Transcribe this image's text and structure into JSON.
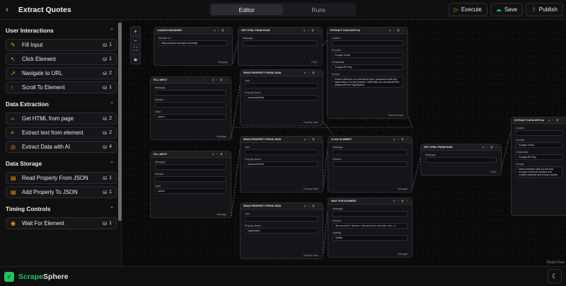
{
  "header": {
    "back_icon": "chevron-left-icon",
    "title": "Extract Quotes",
    "tabs": [
      "Editor",
      "Runs"
    ],
    "execute_label": "Execute",
    "save_label": "Save",
    "publish_label": "Publish"
  },
  "sidebar": {
    "sections": [
      {
        "title": "User Interactions",
        "items": [
          {
            "label": "Fill Input",
            "count": "1",
            "icon": "input-icon"
          },
          {
            "label": "Click Element",
            "count": "1",
            "icon": "cursor-click-icon"
          },
          {
            "label": "Navigate to URL",
            "count": "2",
            "icon": "link-icon"
          },
          {
            "label": "Scroll To Element",
            "count": "1",
            "icon": "arrow-up-icon"
          }
        ]
      },
      {
        "title": "Data Extraction",
        "items": [
          {
            "label": "Get HTML from page",
            "count": "2",
            "icon": "code-icon"
          },
          {
            "label": "Extract text from element",
            "count": "2",
            "icon": "text-icon"
          },
          {
            "label": "Extract Data with AI",
            "count": "4",
            "icon": "brain-icon"
          }
        ]
      },
      {
        "title": "Data Storage",
        "items": [
          {
            "label": "Read Property From JSON",
            "count": "1",
            "icon": "file-json-icon"
          },
          {
            "label": "Add Property To JSON",
            "count": "1",
            "icon": "file-plus-icon"
          }
        ]
      },
      {
        "title": "Timing Controls",
        "items": [
          {
            "label": "Wait For Element",
            "count": "1",
            "icon": "eye-icon"
          }
        ]
      }
    ]
  },
  "footer": {
    "brand_a": "Scrape",
    "brand_b": "Sphere",
    "attribution": "React Flow"
  },
  "nodes": [
    {
      "title": "LAUNCH BROWSER",
      "fields": [
        {
          "label": "Website Url",
          "value": "https://quotes.toscrape.com/login"
        }
      ],
      "out": "Webpage"
    },
    {
      "title": "GET HTML FROM PAGE",
      "fields": [
        {
          "label": "Webpage",
          "value": ""
        }
      ],
      "out": "HTML"
    },
    {
      "title": "EXTRACT DATA WITH AI",
      "fields": [
        {
          "label": "Content",
          "value": ""
        },
        {
          "label": "Provider",
          "value": "Google GenAI"
        },
        {
          "label": "Credentials",
          "value": "Google API Key"
        },
        {
          "label": "Prompt",
          "value": "Extract selectors for username input, password input and login button in a json format. Label them as usernameField, passwordField, loginButton"
        }
      ],
      "out": "Extracted Data"
    },
    {
      "title": "FILL INPUT",
      "fields": [
        {
          "label": "Webpage",
          "value": ""
        },
        {
          "label": "Selector",
          "value": ""
        },
        {
          "label": "Value",
          "value": "admin"
        }
      ],
      "out": "Webpage"
    },
    {
      "title": "READ PROPERTY FROM JSON",
      "fields": [
        {
          "label": "Json",
          "value": ""
        },
        {
          "label": "Property Name",
          "value": "usernameField"
        }
      ],
      "out": "Property Value"
    },
    {
      "title": "READ PROPERTY FROM JSON",
      "fields": [
        {
          "label": "Json",
          "value": ""
        },
        {
          "label": "Property Name",
          "value": "passwordField"
        }
      ],
      "out": "Property Value"
    },
    {
      "title": "CLICK ELEMENT",
      "fields": [
        {
          "label": "Webpage",
          "value": ""
        },
        {
          "label": "Selector",
          "value": ""
        }
      ],
      "out": "Webpage"
    },
    {
      "title": "GET HTML FROM PAGE",
      "fields": [
        {
          "label": "Webpage",
          "value": ""
        }
      ],
      "out": "HTML"
    },
    {
      "title": "EXTRACT DATA WITH AI",
      "fields": [
        {
          "label": "Content",
          "value": ""
        },
        {
          "label": "Provider",
          "value": "Google GenAI"
        },
        {
          "label": "Credentials",
          "value": "Google API Key"
        },
        {
          "label": "Prompt",
          "value": "Dear Extractor! Will you be kind enough to find the quote's text content carefully and extract quotes in json format"
        }
      ],
      "out": ""
    },
    {
      "title": "FILL INPUT",
      "fields": [
        {
          "label": "Webpage",
          "value": ""
        },
        {
          "label": "Selector",
          "value": ""
        },
        {
          "label": "Value",
          "value": "admin"
        }
      ],
      "out": "Webpage"
    },
    {
      "title": "READ PROPERTY FROM JSON",
      "fields": [
        {
          "label": "Json",
          "value": ""
        },
        {
          "label": "Property Name",
          "value": "loginButton"
        }
      ],
      "out": "Property Value"
    },
    {
      "title": "WAIT FOR ELEMENT",
      "fields": [
        {
          "label": "Webpage",
          "value": ""
        },
        {
          "label": "Selector",
          "value": "div.col-md-8 > div.row > div.col-md-8 > div.row > div > a"
        },
        {
          "label": "Visibility",
          "value": "Visible"
        }
      ],
      "out": "Webpage"
    }
  ]
}
